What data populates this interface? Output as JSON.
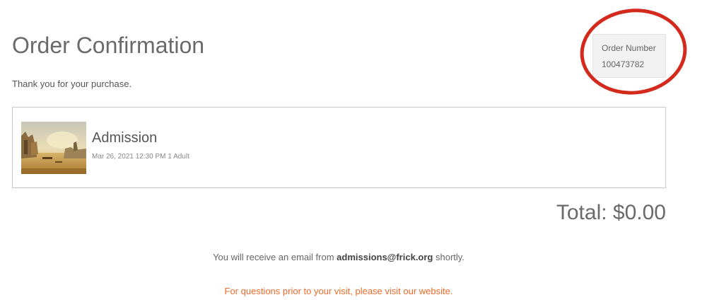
{
  "header": {
    "title": "Order Confirmation",
    "thank_you": "Thank you for your purchase."
  },
  "order": {
    "label": "Order Number",
    "number": "100473782"
  },
  "item": {
    "name": "Admission",
    "details": "Mar 26, 2021 12:30 PM 1 Adult",
    "thumbnail": "landscape-painting-thumbnail"
  },
  "total": {
    "text": "Total: $0.00"
  },
  "footer": {
    "email_prefix": "You will receive an email from ",
    "email_address": "admissions@frick.org",
    "email_suffix": " shortly.",
    "questions_link": "For questions prior to your visit, please visit our website."
  },
  "colors": {
    "accent": "#f06a2a",
    "highlight_circle": "#d42a1e",
    "order_box_bg": "#f1f1f1"
  }
}
